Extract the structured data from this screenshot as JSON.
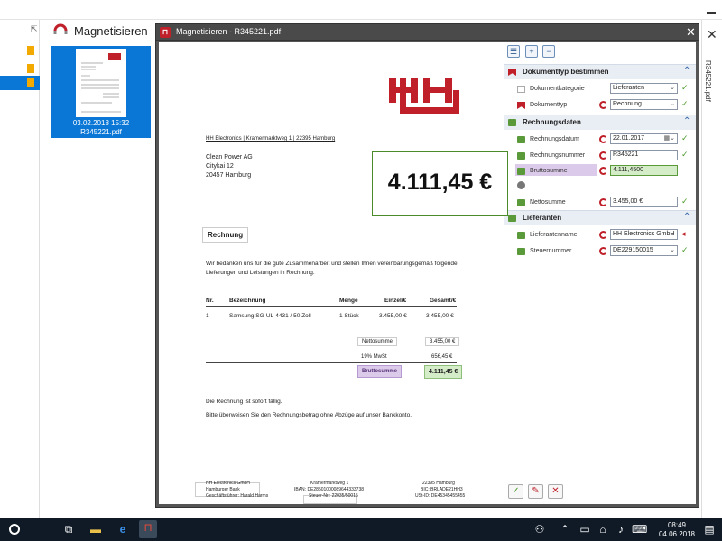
{
  "background_app": {
    "panel_title": "Magnetisieren",
    "thumbnail": {
      "date": "03.02.2018 15:32",
      "filename": "R345221.pdf"
    },
    "right_strip_filename": "R345221.pdf"
  },
  "dialog": {
    "title": "Magnetisieren - R345221.pdf",
    "close_label": "✕",
    "zoom_popup_value": "4.111,45 €"
  },
  "document": {
    "sender_line": "HH Electronics | Kramermarktweg 1 | 22395 Hamburg",
    "recipient": [
      "Clean Power AG",
      "Citykai 12",
      "20457 Hamburg"
    ],
    "heading": "Rechnung",
    "intro": [
      "Wir bedanken uns für die gute Zusammenarbeit und stellen Ihnen vereinbarungsgemäß folgende",
      "Lieferungen und Leistungen in Rechnung."
    ],
    "table_headers": {
      "nr": "Nr.",
      "bez": "Bezeichnung",
      "menge": "Menge",
      "einzel": "Einzel/€",
      "gesamt": "Gesamt/€"
    },
    "table_row": {
      "nr": "1",
      "bez": "Samsung SG-UL-4431 / 50 Zoll",
      "menge": "1 Stück",
      "einzel": "3.455,00 €",
      "gesamt": "3.455,00 €"
    },
    "netto_label": "Nettosumme",
    "netto_value": "3.455,00 €",
    "mwst_label": "19% MwSt",
    "mwst_value": "656,45 €",
    "brutto_label": "Bruttosumme",
    "brutto_value": "4.111,45 €",
    "line1": "Die Rechnung ist sofort fällig.",
    "line2": "Bitte überweisen Sie den Rechnungsbetrag ohne Abzüge auf unser Bankkonto.",
    "footer_left": [
      "HH Electronics GmbH",
      "Hamburger Bank",
      "Geschäftsführer: Harald Harms"
    ],
    "footer_mid": [
      "Kramermarktweg 1",
      "IBAN: DE28501000089644333738",
      "Steuer-Nr.: 22035/50015"
    ],
    "footer_right": [
      "22395 Hamburg",
      "BIC: BRLADE21HH3",
      "USt-ID: DE45345455455"
    ]
  },
  "panel": {
    "sections": {
      "doctype": "Dokumenttyp bestimmen",
      "invoice": "Rechnungsdaten",
      "supplier": "Lieferanten"
    },
    "fields": {
      "kategorie_label": "Dokumentkategorie",
      "kategorie_value": "Lieferanten",
      "typ_label": "Dokumenttyp",
      "typ_value": "Rechnung",
      "datum_label": "Rechnungsdatum",
      "datum_value": "22.01.2017",
      "nummer_label": "Rechnungsnummer",
      "nummer_value": "R345221",
      "brutto_label": "Bruttosumme",
      "brutto_value": "4.111,4500",
      "netto_label": "Nettosumme",
      "netto_value": "3.455,00 €",
      "lieferant_label": "Lieferantenname",
      "lieferant_value": "HH Electronics GmbH",
      "steuer_label": "Steuernummer",
      "steuer_value": "DE229150015"
    }
  },
  "taskbar": {
    "time": "08:49",
    "date": "04.06.2018"
  },
  "colors": {
    "accent_red": "#c0202a",
    "ok_green": "#4a9a2a",
    "highlight_blue": "#0a77d6"
  }
}
